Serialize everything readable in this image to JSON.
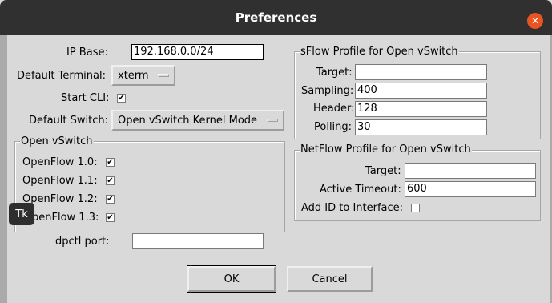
{
  "window": {
    "title": "Preferences"
  },
  "left": {
    "ip_base_label": "IP Base:",
    "ip_base_value": "192.168.0.0/24",
    "default_terminal_label": "Default Terminal:",
    "default_terminal_value": "xterm",
    "start_cli_label": "Start CLI:",
    "start_cli_checked": "✔",
    "default_switch_label": "Default Switch:",
    "default_switch_value": "Open vSwitch Kernel Mode"
  },
  "ovs": {
    "title": "Open vSwitch",
    "items": [
      {
        "label": "OpenFlow 1.0:",
        "check": "✔"
      },
      {
        "label": "OpenFlow 1.1:",
        "check": "✔"
      },
      {
        "label": "OpenFlow 1.2:",
        "check": "✔"
      },
      {
        "label": "penFlow 1.3:",
        "check": "✔"
      }
    ],
    "dpctl_label": "dpctl port:",
    "dpctl_value": ""
  },
  "sflow": {
    "title": "sFlow Profile for Open vSwitch",
    "target_label": "Target:",
    "target_value": "",
    "sampling_label": "Sampling:",
    "sampling_value": "400",
    "header_label": "Header:",
    "header_value": "128",
    "polling_label": "Polling:",
    "polling_value": "30"
  },
  "netflow": {
    "title": "NetFlow Profile for Open vSwitch",
    "target_label": "Target:",
    "target_value": "",
    "timeout_label": "Active Timeout:",
    "timeout_value": "600",
    "addid_label": "Add ID to Interface:"
  },
  "buttons": {
    "ok": "OK",
    "cancel": "Cancel"
  },
  "tooltip": {
    "text": "Tk"
  },
  "colors": {
    "titlebar": "#303030",
    "close": "#e95420",
    "dialog_bg": "#d9d9d9"
  },
  "icons": {
    "close": "close-icon"
  }
}
